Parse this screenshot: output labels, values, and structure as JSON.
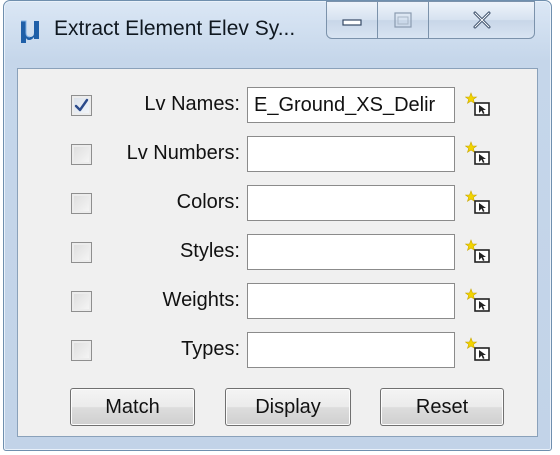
{
  "window": {
    "title": "Extract Element Elev Sy...",
    "accent": "#1f5fa8"
  },
  "title_controls": [
    "minimize-icon",
    "maximize-icon",
    "close-icon"
  ],
  "rows": [
    {
      "label": "Lv Names:",
      "checked": true,
      "value": "E_Ground_XS_Delir"
    },
    {
      "label": "Lv Numbers:",
      "checked": false,
      "value": ""
    },
    {
      "label": "Colors:",
      "checked": false,
      "value": ""
    },
    {
      "label": "Styles:",
      "checked": false,
      "value": ""
    },
    {
      "label": "Weights:",
      "checked": false,
      "value": ""
    },
    {
      "label": "Types:",
      "checked": false,
      "value": ""
    }
  ],
  "buttons": {
    "match": "Match",
    "display": "Display",
    "reset": "Reset"
  },
  "pick_icon": "select-element-icon"
}
